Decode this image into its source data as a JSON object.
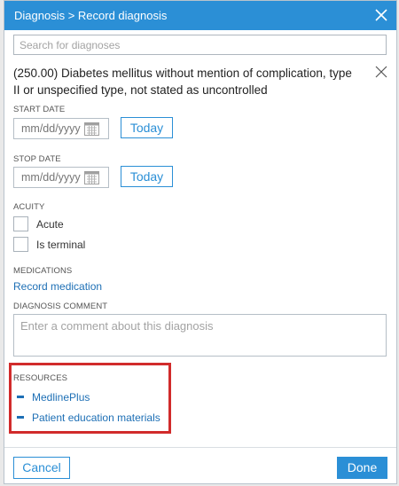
{
  "header": {
    "title": "Diagnosis > Record diagnosis"
  },
  "search": {
    "placeholder": "Search for diagnoses"
  },
  "diagnosis": {
    "text": "(250.00) Diabetes mellitus without mention of complication, type II or unspecified type, not stated as uncontrolled"
  },
  "start_date": {
    "label": "START DATE",
    "placeholder": "mm/dd/yyyy",
    "today_label": "Today"
  },
  "stop_date": {
    "label": "STOP DATE",
    "placeholder": "mm/dd/yyyy",
    "today_label": "Today"
  },
  "acuity": {
    "label": "ACUITY",
    "options": [
      {
        "label": "Acute",
        "checked": false
      },
      {
        "label": "Is terminal",
        "checked": false
      }
    ]
  },
  "medications": {
    "label": "MEDICATIONS",
    "link": "Record medication"
  },
  "comment": {
    "label": "DIAGNOSIS COMMENT",
    "placeholder": "Enter a comment about this diagnosis"
  },
  "resources": {
    "label": "RESOURCES",
    "items": [
      "MedlinePlus",
      "Patient education materials"
    ]
  },
  "footer": {
    "cancel_label": "Cancel",
    "done_label": "Done"
  },
  "colors": {
    "accent": "#2b8fd6",
    "link": "#1d6fb5",
    "highlight": "#d12b2b"
  }
}
